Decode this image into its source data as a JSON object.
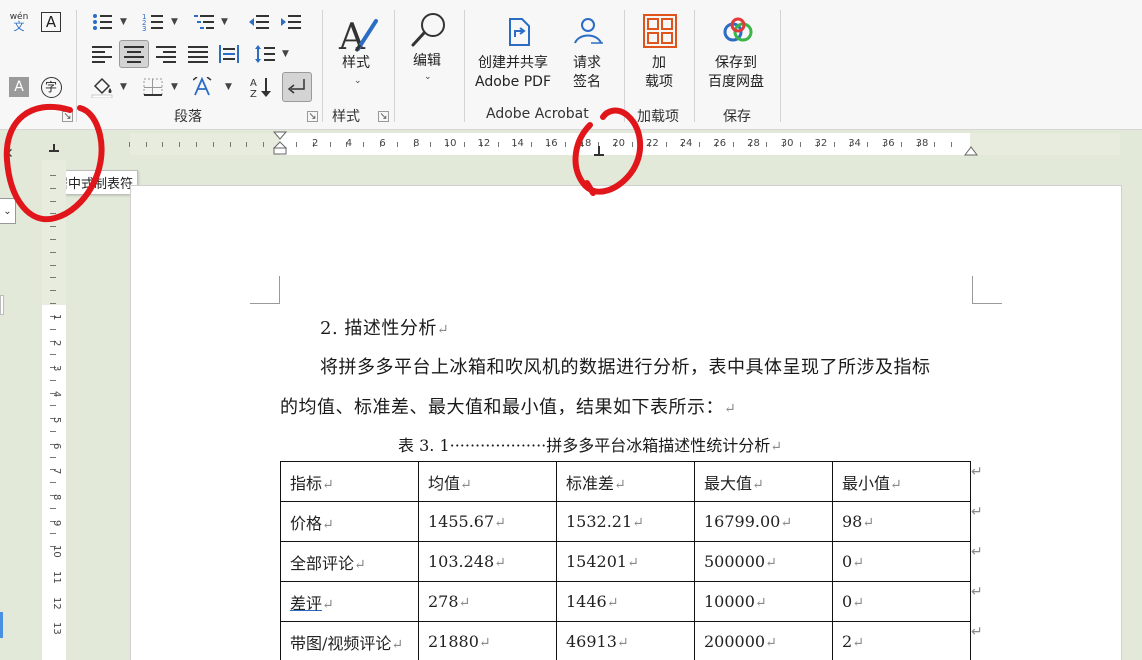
{
  "ribbon": {
    "groups": {
      "paragraph": "段落",
      "styles": "样式",
      "adobe": "Adobe Acrobat",
      "addins": "加载项",
      "save": "保存"
    },
    "buttons": {
      "styles_line1": "样式",
      "edit": "编辑",
      "create_share_l1": "创建并共享",
      "create_share_l2": "Adobe PDF",
      "request_sign_l1": "请求",
      "request_sign_l2": "签名",
      "addins_l1": "加",
      "addins_l2": "载项",
      "baidu_l1": "保存到",
      "baidu_l2": "百度网盘",
      "phonetic_top": "wén",
      "phonetic_bottom": "文",
      "enclose_char": "字",
      "char_shading": "A",
      "charborder": "A"
    }
  },
  "ruler": {
    "h_numbers": [
      "2",
      "4",
      "6",
      "8",
      "10",
      "12",
      "14",
      "16",
      "18",
      "20",
      "22",
      "24",
      "26",
      "28",
      "30",
      "32",
      "34",
      "36",
      "38"
    ],
    "v_numbers": [
      "1",
      "2",
      "3",
      "4",
      "5",
      "6",
      "7",
      "8",
      "9",
      "10",
      "11",
      "12",
      "13"
    ],
    "tooltip": "居中式制表符"
  },
  "document": {
    "heading": "2. 描述性分析",
    "para_line1": "将拼多多平台上冰箱和吹风机的数据进行分析，表中具体呈现了所涉及指标",
    "para_line2": "的均值、标准差、最大值和最小值，结果如下表所示：",
    "caption": "表 3. 1···················拼多多平台冰箱描述性统计分析",
    "pilcrow": "↵",
    "table": {
      "headers": [
        "指标",
        "均值",
        "标准差",
        "最大值",
        "最小值"
      ],
      "rows": [
        [
          "价格",
          "1455.67",
          "1532.21",
          "16799.00",
          "98"
        ],
        [
          "全部评论",
          "103.248",
          "154201",
          "500000",
          "0"
        ],
        [
          "差评",
          "278",
          "1446",
          "10000",
          "0"
        ],
        [
          "带图/视频评论",
          "21880",
          "46913",
          "200000",
          "2"
        ]
      ]
    }
  },
  "colors": {
    "annotation": "#e0161b",
    "ruler_bg": "#e8ecdf",
    "workspace": "#e3e9d9"
  }
}
